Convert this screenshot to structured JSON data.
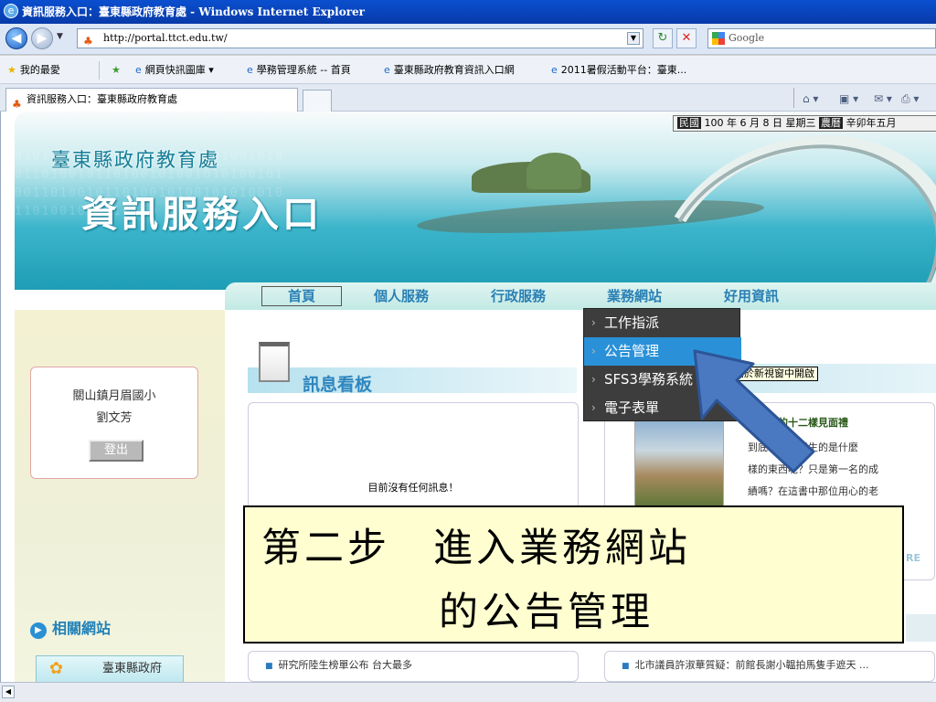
{
  "window": {
    "title": "資訊服務入口：臺東縣政府教育處 - Windows Internet Explorer"
  },
  "address_bar": {
    "url": "http://portal.ttct.edu.tw/",
    "search_placeholder": "Google"
  },
  "favorites": {
    "label": "我的最愛",
    "items": [
      {
        "label": "網頁快訊圖庫 ▾"
      },
      {
        "label": "學務管理系統 -- 首頁"
      },
      {
        "label": "臺東縣政府教育資訊入口網"
      },
      {
        "label": "2011暑假活動平台：臺東..."
      }
    ]
  },
  "tabs": {
    "active_label": "資訊服務入口：臺東縣政府教育處"
  },
  "page": {
    "header_subtitle": "臺東縣政府教育處",
    "header_title": "資訊服務入口",
    "date_prefix_tag": "民國",
    "date_text": " 100 年 6 月 8 日 星期三 ",
    "lunar_tag": "農曆",
    "lunar_text": " 辛卯年五月",
    "nav": [
      {
        "label": "首頁"
      },
      {
        "label": "個人服務"
      },
      {
        "label": "行政服務"
      },
      {
        "label": "業務網站"
      },
      {
        "label": "好用資訊"
      }
    ],
    "dropdown": [
      {
        "label": "工作指派"
      },
      {
        "label": "公告管理"
      },
      {
        "label": "SFS3學務系統"
      },
      {
        "label": "電子表單"
      }
    ],
    "tooltip": "此連結於新視窗中開啟",
    "login": {
      "school": "關山鎮月眉國小",
      "user": "劉文芳",
      "logout_label": "登出"
    },
    "infoboard_title": "訊息看板",
    "no_message": "目前沒有任何訊息！",
    "book": {
      "title": "的十二樣見面禮",
      "lines": [
        "到底可以給學生的是什麼",
        "樣的東西呢？只是第一名的成",
        "績嗎？在這書中那位用心的老"
      ]
    },
    "more_label": "RE",
    "related_sites": "相關網站",
    "taitung_link": "臺東縣政府",
    "news": [
      {
        "text": "研究所陸生榜單公布 台大最多"
      },
      {
        "text": "北市議員許淑華質疑：前館長謝小韞拍馬隻手遮天 ..."
      }
    ]
  },
  "instruction": {
    "line1": "第二步　進入業務網站",
    "line2": "的公告管理"
  },
  "colors": {
    "accent": "#2a91d8",
    "instruction_bg": "#fefed0",
    "arrow": "#4a79c2"
  }
}
